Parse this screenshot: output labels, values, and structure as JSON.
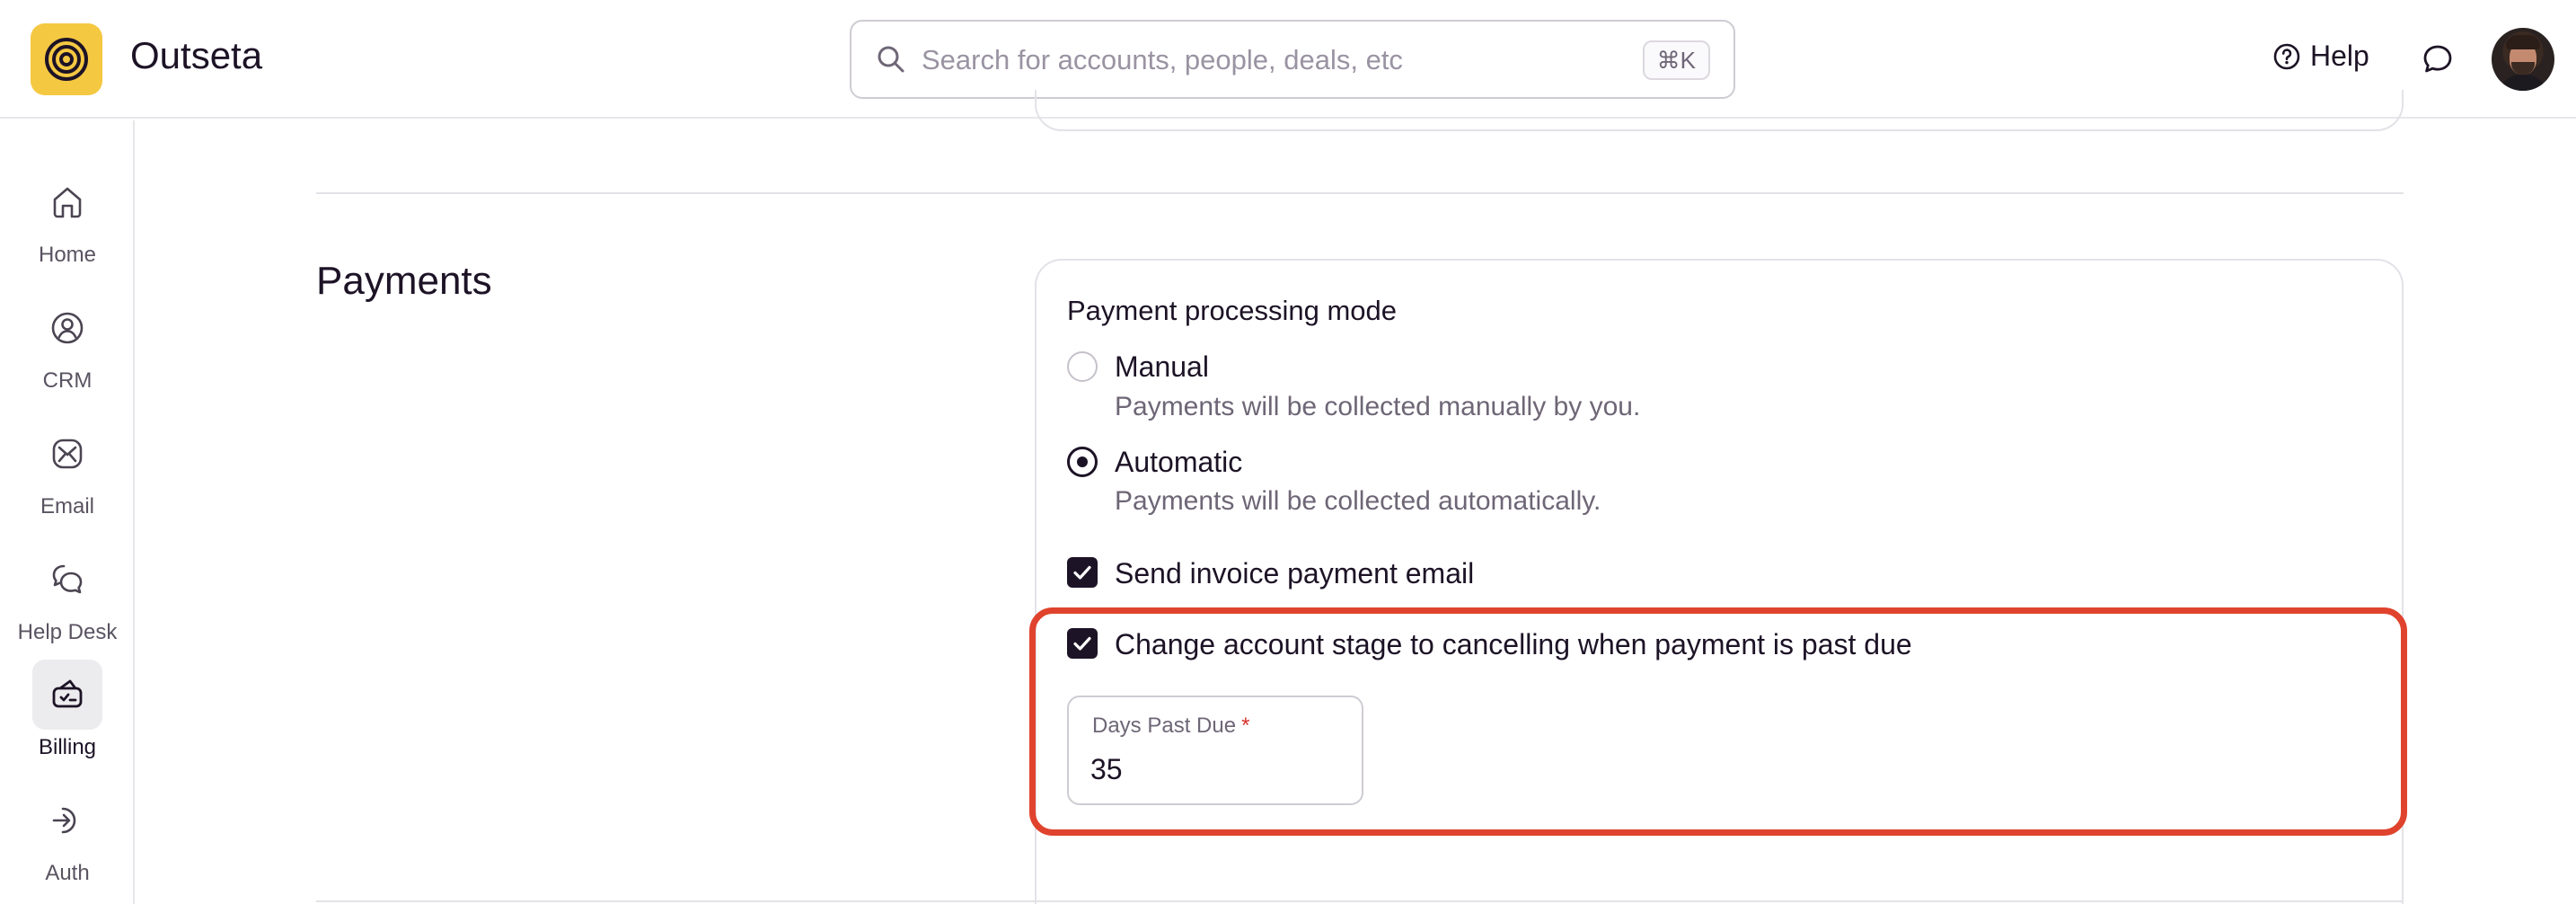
{
  "header": {
    "app_name": "Outseta",
    "search_placeholder": "Search for accounts, people, deals, etc",
    "search_value": "",
    "search_shortcut": "⌘K",
    "help_label": "Help"
  },
  "sidebar": {
    "items": [
      {
        "label": "Home",
        "icon": "home-icon"
      },
      {
        "label": "CRM",
        "icon": "crm-icon"
      },
      {
        "label": "Email",
        "icon": "email-icon"
      },
      {
        "label": "Help Desk",
        "icon": "help-desk-icon"
      },
      {
        "label": "Billing",
        "icon": "billing-icon",
        "active": true
      },
      {
        "label": "Auth",
        "icon": "auth-icon"
      }
    ]
  },
  "main": {
    "section_title": "Payments",
    "payment_mode": {
      "label": "Payment processing mode",
      "options": [
        {
          "label": "Manual",
          "description": "Payments will be collected manually by you.",
          "selected": false
        },
        {
          "label": "Automatic",
          "description": "Payments will be collected automatically.",
          "selected": true
        }
      ]
    },
    "send_invoice_email": {
      "label": "Send invoice payment email",
      "checked": true
    },
    "cancel_on_past_due": {
      "label": "Change account stage to cancelling when payment is past due",
      "checked": true
    },
    "days_past_due": {
      "label": "Days Past Due",
      "required_mark": "*",
      "value": "35"
    }
  },
  "colors": {
    "accent_dark": "#1d1326",
    "logo_yellow": "#f5c842",
    "highlight_red": "#e0432d"
  }
}
